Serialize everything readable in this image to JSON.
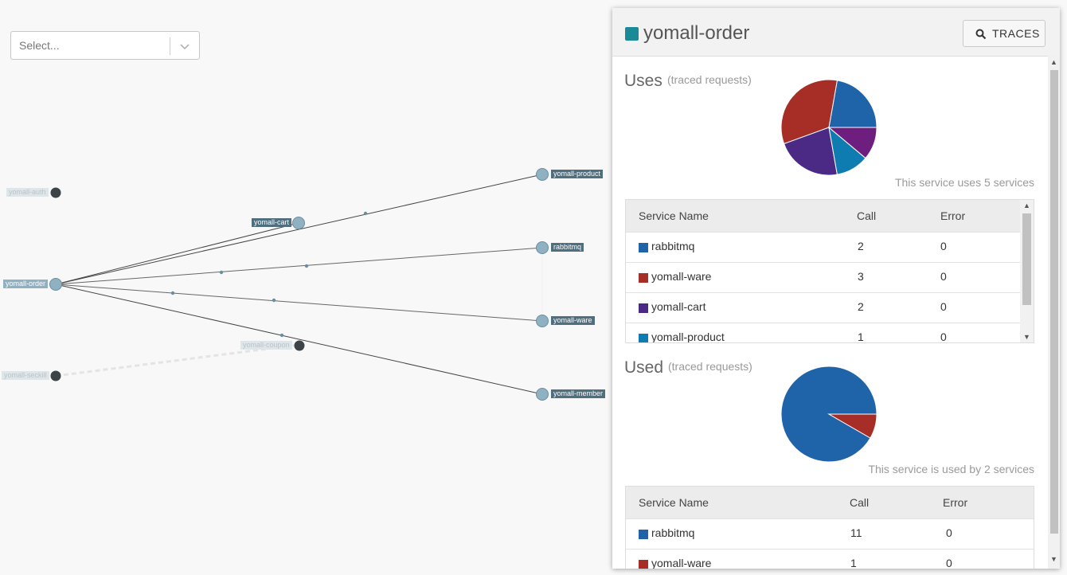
{
  "select": {
    "placeholder": "Select..."
  },
  "graph": {
    "nodes": [
      {
        "label": "yomall-auth"
      },
      {
        "label": "yomall-cart"
      },
      {
        "label": "yomall-order"
      },
      {
        "label": "yomall-coupon"
      },
      {
        "label": "yomall-seckill"
      },
      {
        "label": "yomall-product"
      },
      {
        "label": "rabbitmq"
      },
      {
        "label": "yomall-ware"
      },
      {
        "label": "yomall-member"
      }
    ]
  },
  "panel": {
    "title": "yomall-order",
    "title_color": "#1a8a96",
    "traces_label": "TRACES",
    "uses": {
      "title": "Uses",
      "subtitle": "(traced requests)",
      "note": "This service uses 5 services",
      "columns": [
        "Service Name",
        "Call",
        "Error"
      ],
      "rows": [
        {
          "name": "rabbitmq",
          "call": "2",
          "error": "0",
          "color": "#1f63a8"
        },
        {
          "name": "yomall-ware",
          "call": "3",
          "error": "0",
          "color": "#a72e27"
        },
        {
          "name": "yomall-cart",
          "call": "2",
          "error": "0",
          "color": "#4b2a86"
        },
        {
          "name": "yomall-product",
          "call": "1",
          "error": "0",
          "color": "#0e7cb0"
        }
      ]
    },
    "used": {
      "title": "Used",
      "subtitle": "(traced requests)",
      "note": "This service is used by 2 services",
      "columns": [
        "Service Name",
        "Call",
        "Error"
      ],
      "rows": [
        {
          "name": "rabbitmq",
          "call": "11",
          "error": "0",
          "color": "#1f63a8"
        },
        {
          "name": "yomall-ware",
          "call": "1",
          "error": "0",
          "color": "#a72e27"
        }
      ]
    }
  },
  "chart_data": [
    {
      "type": "pie",
      "values": [
        2,
        3,
        2,
        1,
        1
      ],
      "colors": [
        "#1f63a8",
        "#a72e27",
        "#4b2a86",
        "#0e7cb0",
        "#6e1e7e"
      ]
    },
    {
      "type": "pie",
      "values": [
        11,
        1
      ],
      "colors": [
        "#1f63a8",
        "#a72e27"
      ]
    }
  ]
}
